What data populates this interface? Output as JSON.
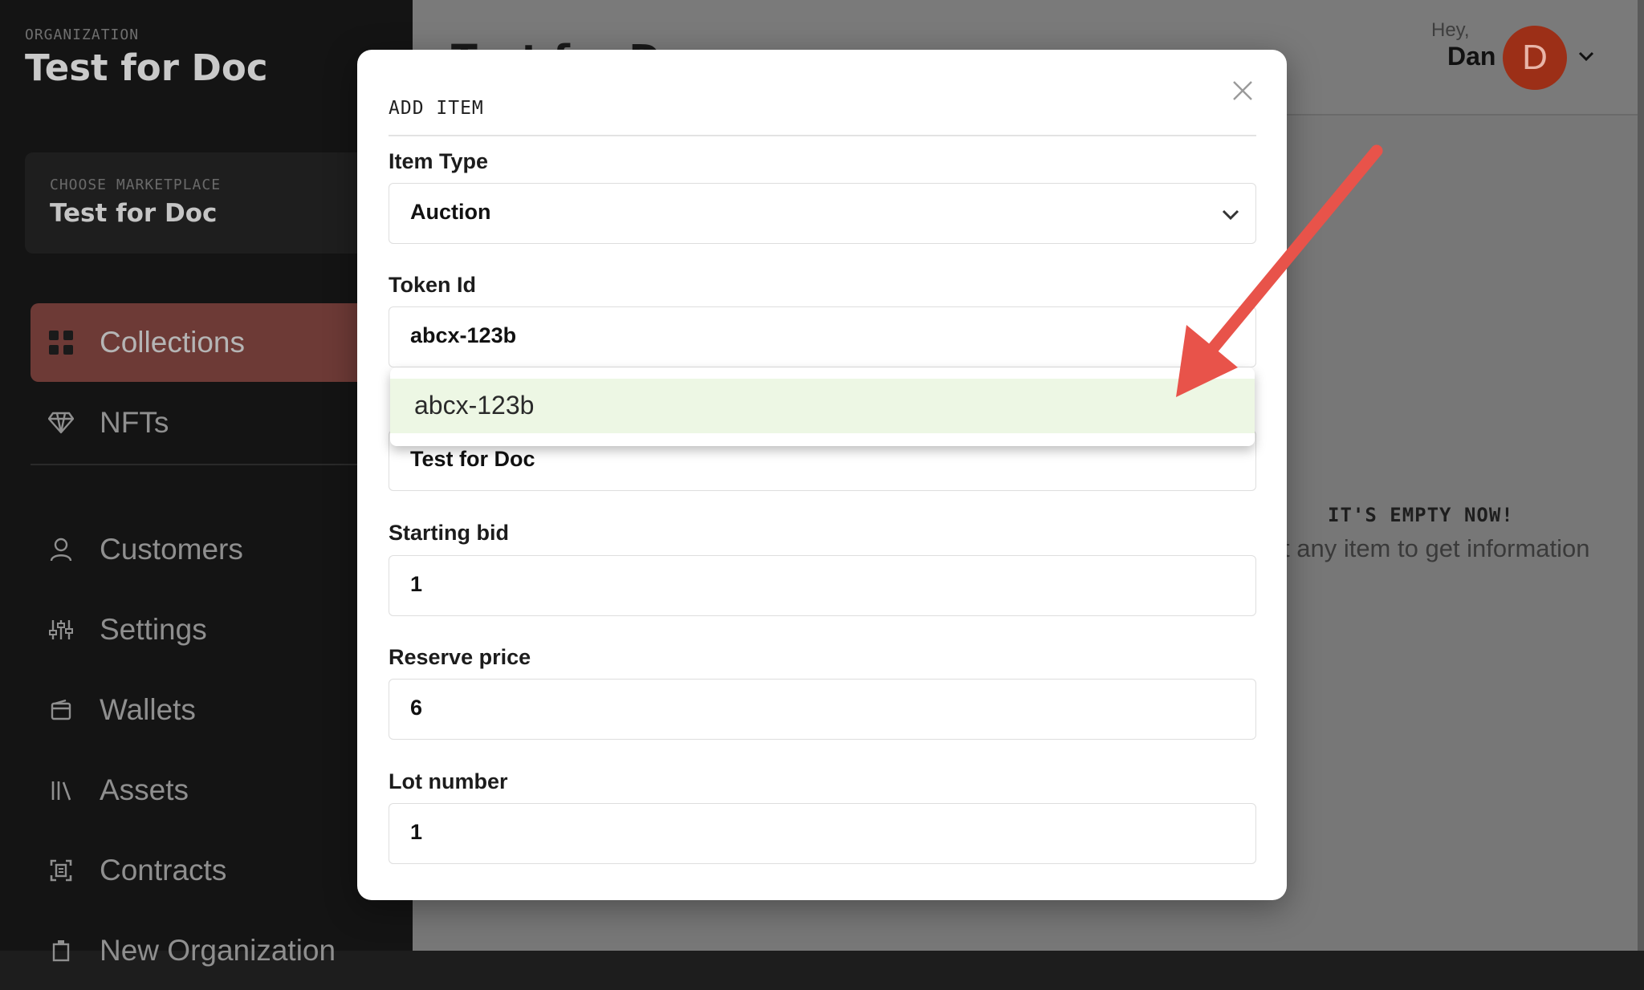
{
  "sidebar": {
    "org_label": "ORGANIZATION",
    "org_name": "Test for Doc",
    "marketplace_label": "CHOOSE MARKETPLACE",
    "marketplace_name": "Test for Doc",
    "items": [
      {
        "label": "Collections",
        "icon": "grid-icon",
        "active": true
      },
      {
        "label": "NFTs",
        "icon": "diamond-icon",
        "active": false
      },
      {
        "label": "Customers",
        "icon": "user-icon",
        "active": false
      },
      {
        "label": "Settings",
        "icon": "sliders-icon",
        "active": false
      },
      {
        "label": "Wallets",
        "icon": "wallet-icon",
        "active": false
      },
      {
        "label": "Assets",
        "icon": "library-icon",
        "active": false
      },
      {
        "label": "Contracts",
        "icon": "contract-icon",
        "active": false
      },
      {
        "label": "New Organization",
        "icon": "building-icon",
        "active": false
      }
    ]
  },
  "header": {
    "title": "Test for Doc",
    "greeting": "Hey,",
    "user_name": "Dan",
    "avatar_initial": "D"
  },
  "empty_state": {
    "title": "IT'S EMPTY NOW!",
    "subtitle": "t any item to get information"
  },
  "modal": {
    "title": "ADD ITEM",
    "fields": {
      "item_type": {
        "label": "Item Type",
        "value": "Auction"
      },
      "token_id": {
        "label": "Token Id",
        "value": "abcx-123b"
      },
      "collection": {
        "value": "Test for Doc"
      },
      "starting_bid": {
        "label": "Starting bid",
        "value": "1"
      },
      "reserve_price": {
        "label": "Reserve price",
        "value": "6"
      },
      "lot_number": {
        "label": "Lot number",
        "value": "1"
      }
    },
    "dropdown_options": [
      "abcx-123b"
    ]
  },
  "colors": {
    "accent": "#6d3a36",
    "avatar": "#9c2f17",
    "arrow": "#e8534a",
    "option_highlight": "#edf7e4"
  }
}
